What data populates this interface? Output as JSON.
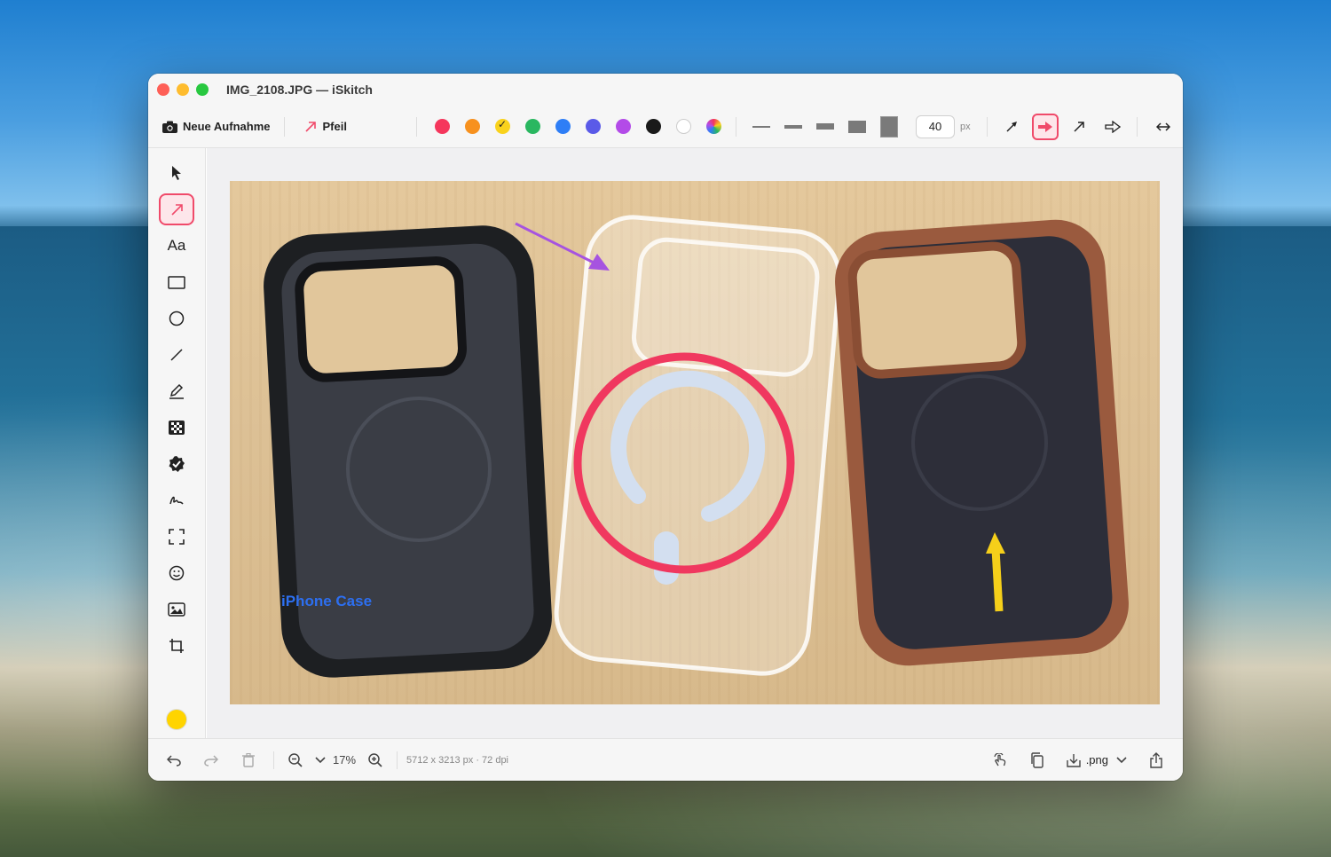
{
  "window": {
    "title": "IMG_2108.JPG — iSkitch",
    "traffic_colors": [
      "#fe5f57",
      "#febc2e",
      "#28c840"
    ]
  },
  "toolbar": {
    "capture_label": "Neue Aufnahme",
    "tool_label": "Pfeil",
    "colors": [
      "#f5365c",
      "#f7911e",
      "#f9d21c",
      "#2ab760",
      "#2e7ef6",
      "#5a5ae8",
      "#b34be8",
      "#1a1a1a",
      "#ffffff",
      "rainbow"
    ],
    "selected_color_index": 2,
    "stroke_width": "40",
    "stroke_unit": "px",
    "arrow_styles": [
      "thin-arrow",
      "filled-arrow",
      "line-arrow",
      "outline-arrow"
    ],
    "selected_arrow_index": 1
  },
  "sidebar": {
    "tools": [
      "select",
      "arrow",
      "text",
      "rectangle",
      "ellipse",
      "line",
      "pen",
      "pixelate",
      "stamp",
      "signature",
      "selection",
      "emoji",
      "image",
      "crop"
    ],
    "text_tool_label": "Aa",
    "active_tool_index": 1,
    "current_color": "#ffd400"
  },
  "canvas": {
    "annotation_text": "iPhone Case",
    "annotation_text_color": "#2d6ff0",
    "circle_color": "#f0385f",
    "arrow_purple_color": "#a653e0",
    "arrow_yellow_color": "#f5cf1a"
  },
  "statusbar": {
    "zoom": "17%",
    "image_info": "5712 x 3213 px · 72 dpi",
    "format": ".png"
  }
}
